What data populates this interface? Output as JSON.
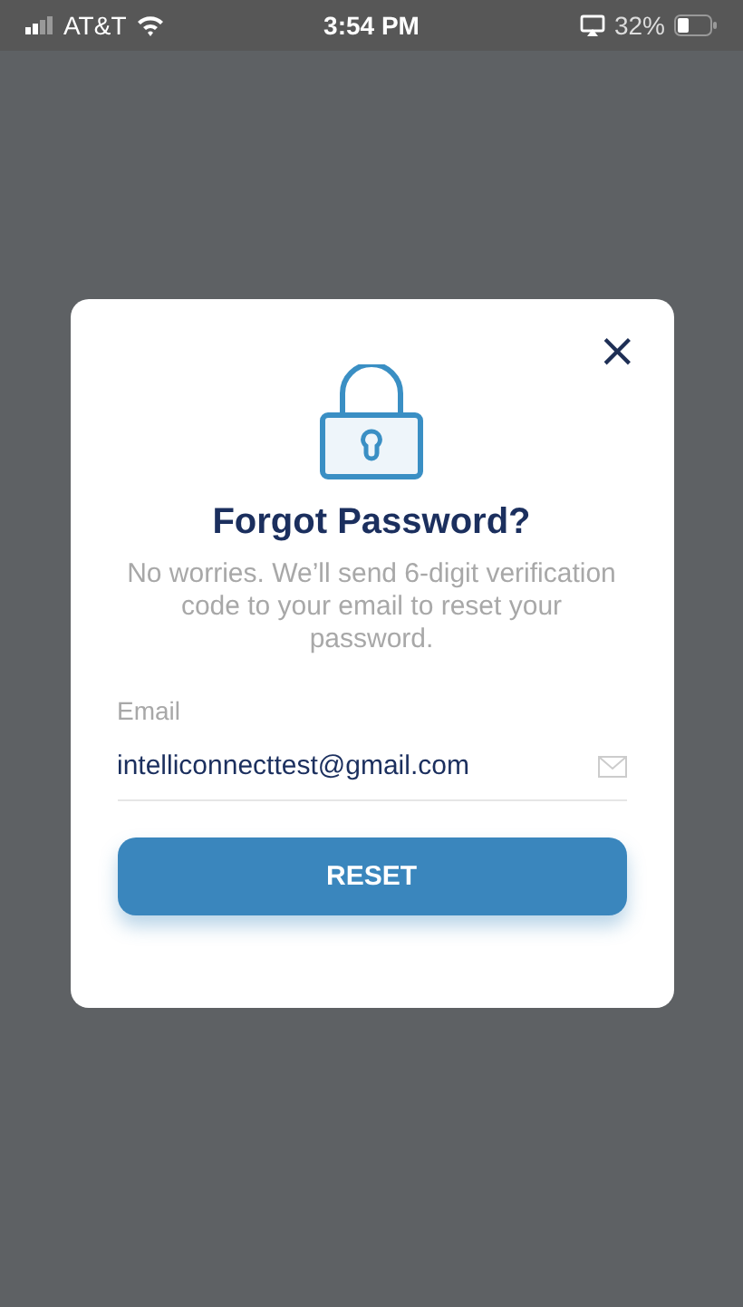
{
  "status_bar": {
    "carrier": "AT&T",
    "time": "3:54 PM",
    "battery_percent": "32%"
  },
  "dialog": {
    "close": "×",
    "title": "Forgot Password?",
    "message": "No worries. We’ll send 6-digit verification code to your email to reset your password.",
    "email_label": "Email",
    "email_value": "intelliconnecttest@gmail.com",
    "button": "RESET"
  }
}
